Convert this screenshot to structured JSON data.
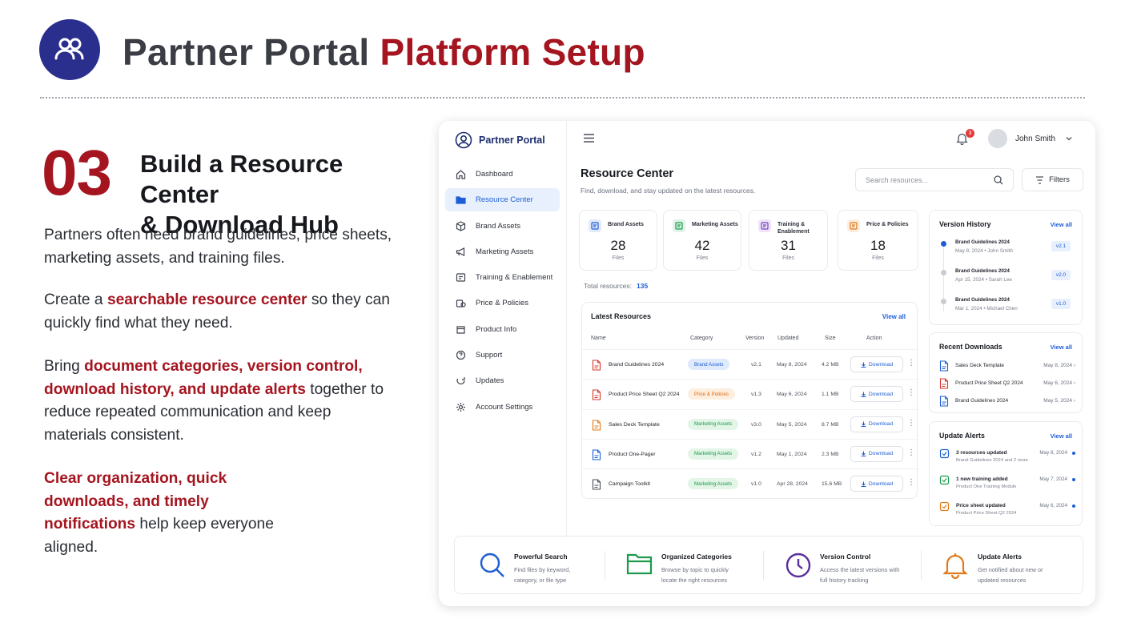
{
  "header": {
    "title_part1": "Partner Portal",
    "title_part2": "Platform Setup",
    "logo_icon": "users-icon"
  },
  "step": {
    "number": "03",
    "heading_line1": "Build a Resource Center",
    "heading_line2": "& Download Hub"
  },
  "body": {
    "p1": "Partners often need brand guidelines, price sheets, marketing assets, and training files.",
    "p2_pre": "Create a ",
    "p2_hl": "searchable resource center",
    "p2_post": " so they can quickly find what they need.",
    "p3_pre": "Bring ",
    "p3_hl": "document categories, version control, download history, and update alerts",
    "p3_post": " together to reduce repeated communication and keep materials consistent.",
    "p4_hl": "Clear organization, quick downloads, and timely notifications",
    "p4_post": " help keep everyone aligned."
  },
  "app": {
    "brand": "Partner Portal",
    "nav": [
      {
        "label": "Dashboard",
        "icon": "home-icon"
      },
      {
        "label": "Resource Center",
        "icon": "folder-icon",
        "active": true
      },
      {
        "label": "Brand Assets",
        "icon": "cube-icon"
      },
      {
        "label": "Marketing Assets",
        "icon": "megaphone-icon"
      },
      {
        "label": "Training & Enablement",
        "icon": "graduation-icon"
      },
      {
        "label": "Price & Policies",
        "icon": "price-icon"
      },
      {
        "label": "Product Info",
        "icon": "box-icon"
      },
      {
        "label": "Support",
        "icon": "help-icon"
      },
      {
        "label": "Updates",
        "icon": "refresh-icon"
      },
      {
        "label": "Account Settings",
        "icon": "gear-icon"
      }
    ],
    "notifications_count": "3",
    "user_name": "John Smith",
    "page_title": "Resource Center",
    "page_subtitle": "Find, download, and stay updated on the latest resources.",
    "search_placeholder": "Search resources...",
    "filters_label": "Filters",
    "stats": [
      {
        "label": "Brand Assets",
        "value": "28",
        "unit": "Files",
        "color": "#1c5ed6"
      },
      {
        "label": "Marketing Assets",
        "value": "42",
        "unit": "Files",
        "color": "#1a9a4a"
      },
      {
        "label": "Training & Enablement",
        "value": "31",
        "unit": "Files",
        "color": "#7b3fc6"
      },
      {
        "label": "Price & Policies",
        "value": "18",
        "unit": "Files",
        "color": "#e07a1a"
      }
    ],
    "total_label": "Total resources:",
    "total_value": "135",
    "latest": {
      "title": "Latest Resources",
      "view_all": "View all",
      "columns": [
        "Name",
        "Category",
        "Version",
        "Updated",
        "Size",
        "Action"
      ],
      "rows": [
        {
          "name": "Brand Guidelines 2024",
          "category": "Brand Assets",
          "cat_bg": "#dfeafc",
          "cat_fg": "#1c5ed6",
          "icon_color": "#d9342b",
          "version": "v2.1",
          "updated": "May 8, 2024",
          "size": "4.2 MB",
          "action": "Download"
        },
        {
          "name": "Product Price Sheet Q2 2024",
          "category": "Price & Policies",
          "cat_bg": "#fdeede",
          "cat_fg": "#d86b12",
          "icon_color": "#d9342b",
          "version": "v1.3",
          "updated": "May 6, 2024",
          "size": "1.1 MB",
          "action": "Download"
        },
        {
          "name": "Sales Deck Template",
          "category": "Marketing Assets",
          "cat_bg": "#e2f5e7",
          "cat_fg": "#1a9a4a",
          "icon_color": "#e07a1a",
          "version": "v3.0",
          "updated": "May 5, 2024",
          "size": "8.7 MB",
          "action": "Download"
        },
        {
          "name": "Product One-Pager",
          "category": "Marketing Assets",
          "cat_bg": "#e2f5e7",
          "cat_fg": "#1a9a4a",
          "icon_color": "#1c5ed6",
          "version": "v1.2",
          "updated": "May 1, 2024",
          "size": "2.3 MB",
          "action": "Download"
        },
        {
          "name": "Campaign Toolkit",
          "category": "Marketing Assets",
          "cat_bg": "#e2f5e7",
          "cat_fg": "#1a9a4a",
          "icon_color": "#4a4f5a",
          "version": "v1.0",
          "updated": "Apr 28, 2024",
          "size": "15.6 MB",
          "action": "Download"
        }
      ]
    },
    "version_history": {
      "title": "Version History",
      "view_all": "View all",
      "items": [
        {
          "name": "Brand Guidelines 2024",
          "date": "May 8, 2024",
          "author": "John Smith",
          "version": "v2.1"
        },
        {
          "name": "Brand Guidelines 2024",
          "date": "Apr 15, 2024",
          "author": "Sarah Lee",
          "version": "v2.0"
        },
        {
          "name": "Brand Guidelines 2024",
          "date": "Mar 1, 2024",
          "author": "Michael Chen",
          "version": "v1.0"
        }
      ]
    },
    "recent_downloads": {
      "title": "Recent Downloads",
      "view_all": "View all",
      "items": [
        {
          "name": "Sales Deck Template",
          "date": "May 8, 2024",
          "icon_color": "#1c5ed6"
        },
        {
          "name": "Product Price Sheet Q2 2024",
          "date": "May 6, 2024",
          "icon_color": "#d9342b"
        },
        {
          "name": "Brand Guidelines 2024",
          "date": "May 5, 2024",
          "icon_color": "#1c5ed6"
        }
      ]
    },
    "update_alerts": {
      "title": "Update Alerts",
      "view_all": "View all",
      "items": [
        {
          "title": "3 resources updated",
          "sub": "Brand Guidelines 2024 and 2 more",
          "date": "May 8, 2024",
          "icon_color": "#1c5ed6"
        },
        {
          "title": "1 new training added",
          "sub": "Product One Training Module",
          "date": "May 7, 2024",
          "icon_color": "#1a9a4a"
        },
        {
          "title": "Price sheet updated",
          "sub": "Product Price Sheet Q2 2024",
          "date": "May 6, 2024",
          "icon_color": "#e07a1a"
        }
      ]
    },
    "features": [
      {
        "title": "Powerful Search",
        "desc": "Find files by keyword, category, or file type",
        "icon": "search-icon",
        "color": "#1c5ed6"
      },
      {
        "title": "Organized Categories",
        "desc": "Browse by topic to quickly locate the right resources",
        "icon": "folder-icon",
        "color": "#1a9a4a"
      },
      {
        "title": "Version Control",
        "desc": "Access the latest versions with full history tracking",
        "icon": "clock-icon",
        "color": "#5b2f9e"
      },
      {
        "title": "Update Alerts",
        "desc": "Get notified about new or updated resources",
        "icon": "bell-icon",
        "color": "#e07a1a"
      }
    ]
  },
  "colors": {
    "accent": "#a51520",
    "brand": "#2a2f8e",
    "link": "#1c5ed6"
  }
}
